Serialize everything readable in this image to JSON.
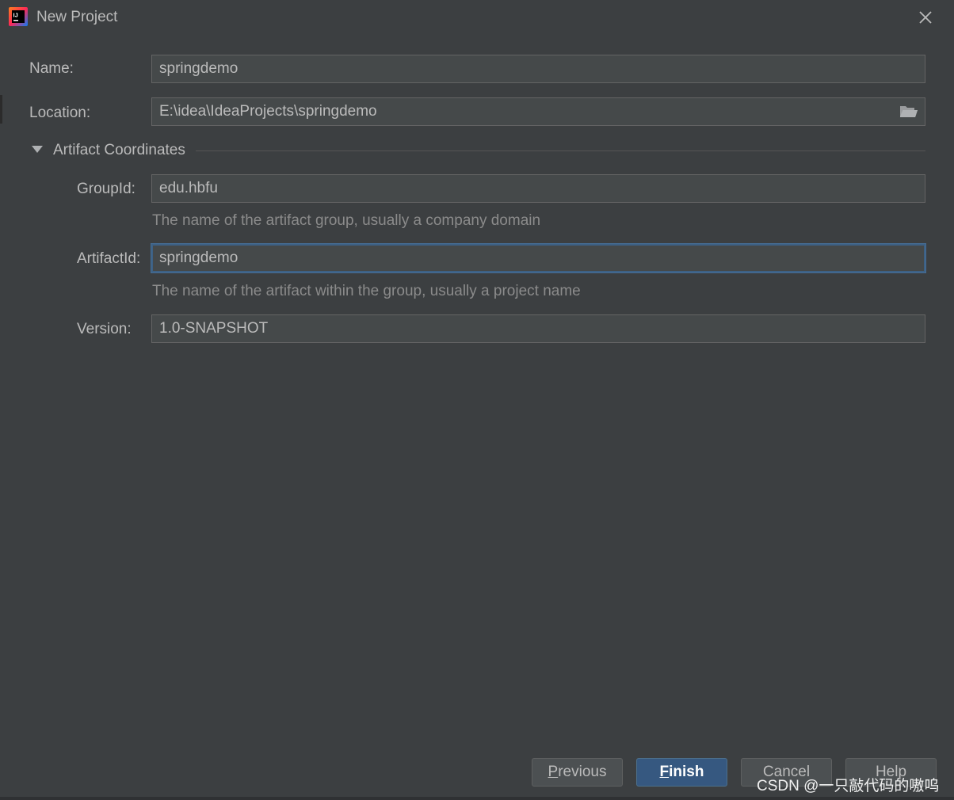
{
  "window": {
    "title": "New Project",
    "app_icon": "intellij-idea-icon",
    "close_icon": "close-icon"
  },
  "form": {
    "name": {
      "label": "Name:",
      "value": "springdemo"
    },
    "location": {
      "label": "Location:",
      "value": "E:\\idea\\IdeaProjects\\springdemo",
      "icon": "folder-icon"
    },
    "artifact_section": {
      "title": "Artifact Coordinates",
      "expanded": true,
      "group_id": {
        "label": "GroupId:",
        "value": "edu.hbfu",
        "hint": "The name of the artifact group, usually a company domain"
      },
      "artifact_id": {
        "label": "ArtifactId:",
        "value": "springdemo",
        "hint": "The name of the artifact within the group, usually a project name",
        "focused": true
      },
      "version": {
        "label": "Version:",
        "value": "1.0-SNAPSHOT"
      }
    }
  },
  "buttons": {
    "previous": {
      "mnemonic": "P",
      "rest": "revious"
    },
    "finish": {
      "mnemonic": "F",
      "rest": "inish"
    },
    "cancel": {
      "label": "Cancel"
    },
    "help": {
      "label": "Help"
    }
  },
  "watermark": "CSDN @一只敲代码的嗷呜",
  "colors": {
    "background": "#3c3f41",
    "field_background": "#45494a",
    "focus_border": "#3d6185",
    "primary_button": "#365880",
    "hint_text": "#8b8b8b"
  }
}
